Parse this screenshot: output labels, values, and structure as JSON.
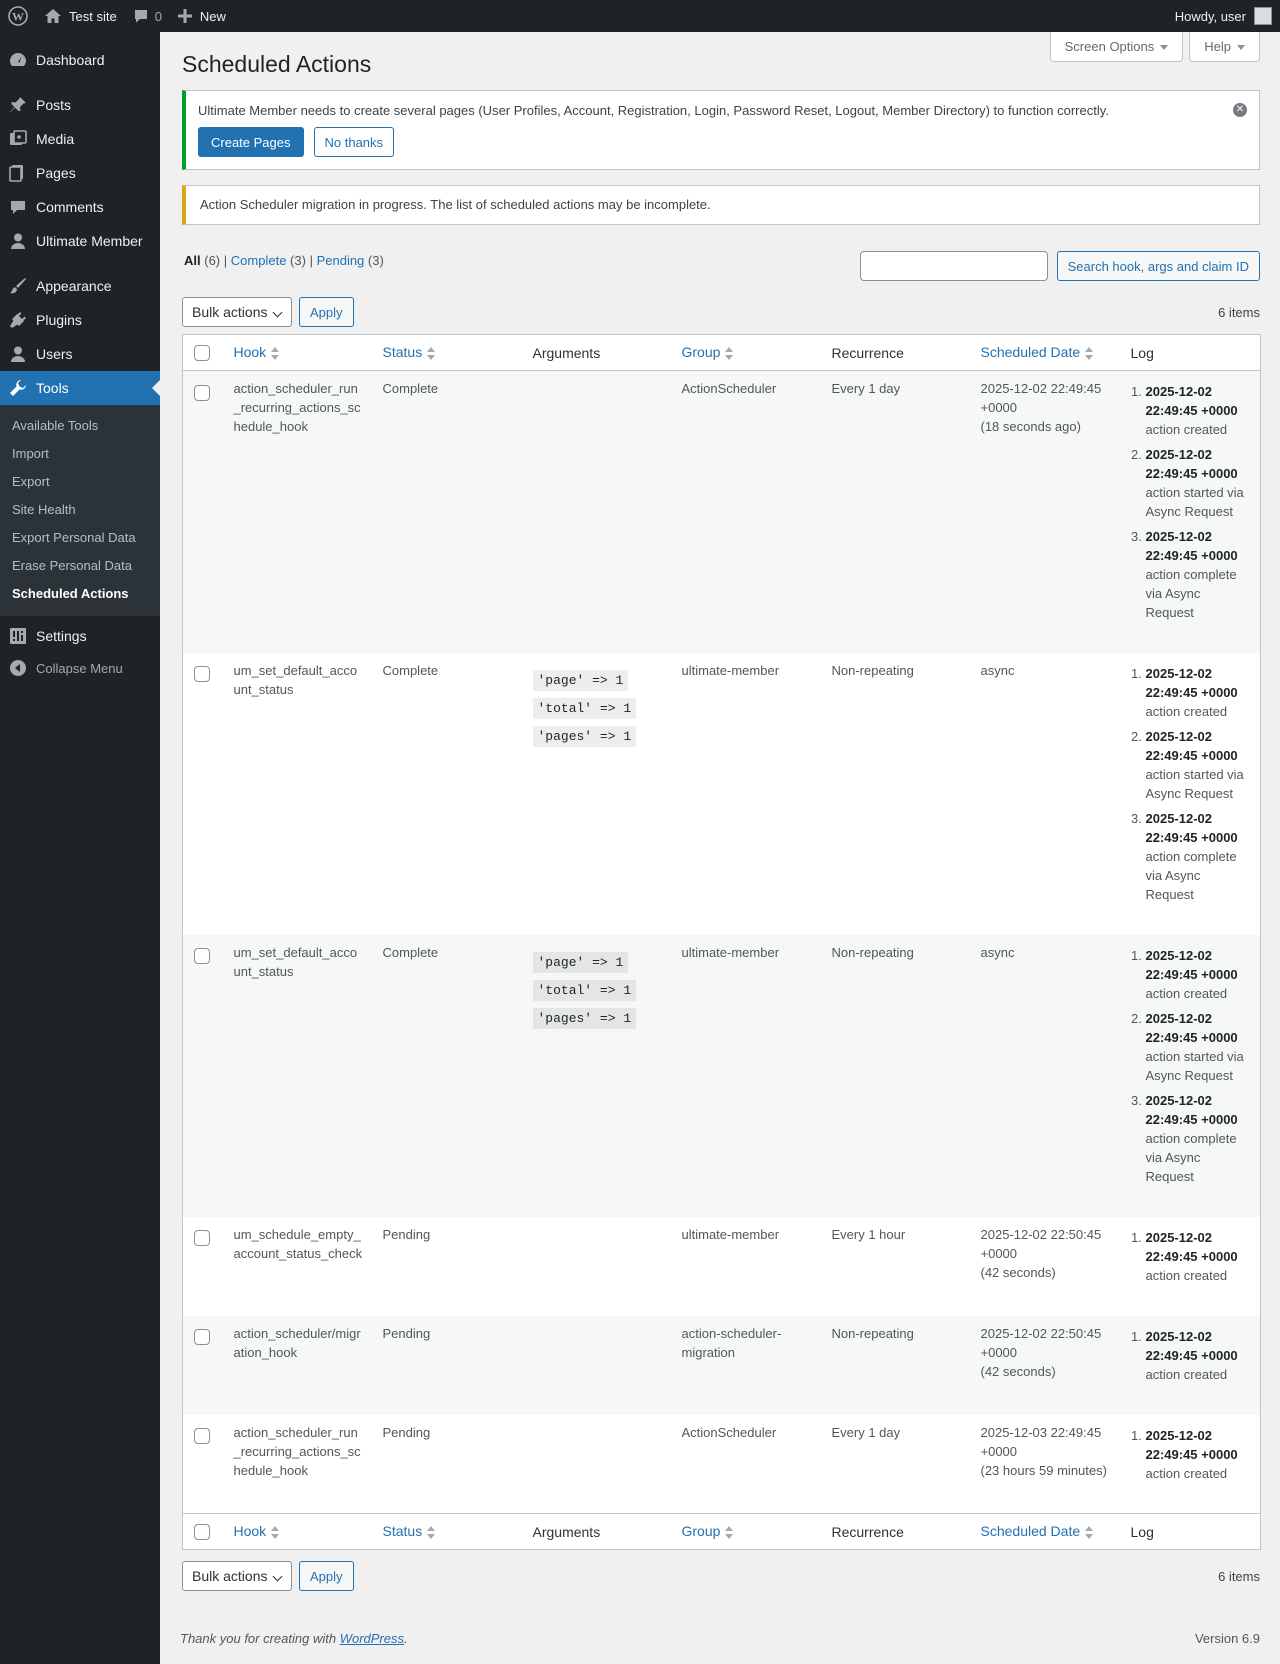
{
  "adminbar": {
    "site_name": "Test site",
    "comments_count": "0",
    "new_label": "New",
    "howdy": "Howdy, user"
  },
  "sidebar": {
    "items": [
      {
        "label": "Dashboard",
        "icon": "dashboard-icon"
      },
      {
        "label": "Posts",
        "icon": "pin-icon"
      },
      {
        "label": "Media",
        "icon": "media-icon"
      },
      {
        "label": "Pages",
        "icon": "pages-icon"
      },
      {
        "label": "Comments",
        "icon": "comment-icon"
      },
      {
        "label": "Ultimate Member",
        "icon": "user-icon"
      },
      {
        "label": "Appearance",
        "icon": "brush-icon"
      },
      {
        "label": "Plugins",
        "icon": "plug-icon"
      },
      {
        "label": "Users",
        "icon": "users-icon"
      },
      {
        "label": "Tools",
        "icon": "wrench-icon"
      },
      {
        "label": "Settings",
        "icon": "settings-icon"
      },
      {
        "label": "Collapse Menu",
        "icon": "collapse-icon"
      }
    ],
    "tools_submenu": [
      "Available Tools",
      "Import",
      "Export",
      "Site Health",
      "Export Personal Data",
      "Erase Personal Data",
      "Scheduled Actions"
    ]
  },
  "screen_meta": {
    "screen_options": "Screen Options",
    "help": "Help"
  },
  "page_title": "Scheduled Actions",
  "notice_um": {
    "text": "Ultimate Member needs to create several pages (User Profiles, Account, Registration, Login, Password Reset, Logout, Member Directory) to function correctly.",
    "create_pages": "Create Pages",
    "no_thanks": "No thanks"
  },
  "notice_migration": "Action Scheduler migration in progress. The list of scheduled actions may be incomplete.",
  "filters": {
    "all": "All",
    "all_count": "(6)",
    "complete": "Complete",
    "complete_count": "(3)",
    "pending": "Pending",
    "pending_count": "(3)",
    "sep": "|"
  },
  "search": {
    "button": "Search hook, args and claim ID",
    "value": ""
  },
  "bulk": {
    "select": "Bulk actions",
    "apply": "Apply",
    "items": "6 items"
  },
  "columns": {
    "hook": "Hook",
    "status": "Status",
    "arguments": "Arguments",
    "group": "Group",
    "recurrence": "Recurrence",
    "scheduled": "Scheduled Date",
    "log": "Log"
  },
  "rows": [
    {
      "hook": "action_scheduler_run_recurring_actions_schedule_hook",
      "status": "Complete",
      "args": [],
      "group": "ActionScheduler",
      "recurrence": "Every 1 day",
      "sched_date": "2025-12-02 22:49:45",
      "sched_tz": "+0000",
      "sched_rel": "(18 seconds ago)",
      "log": [
        {
          "date": "2025-12-02 22:49:45 +0000",
          "msg": "action created"
        },
        {
          "date": "2025-12-02 22:49:45 +0000",
          "msg": "action started via Async Request"
        },
        {
          "date": "2025-12-02 22:49:45 +0000",
          "msg": "action complete via Async Request"
        }
      ]
    },
    {
      "hook": "um_set_default_account_status",
      "status": "Complete",
      "args": [
        "'page' => 1",
        "'total' => 1",
        "'pages' => 1"
      ],
      "group": "ultimate-member",
      "recurrence": "Non-repeating",
      "sched_date": "async",
      "sched_tz": "",
      "sched_rel": "",
      "log": [
        {
          "date": "2025-12-02 22:49:45 +0000",
          "msg": "action created"
        },
        {
          "date": "2025-12-02 22:49:45 +0000",
          "msg": "action started via Async Request"
        },
        {
          "date": "2025-12-02 22:49:45 +0000",
          "msg": "action complete via Async Request"
        }
      ]
    },
    {
      "hook": "um_set_default_account_status",
      "status": "Complete",
      "args": [
        "'page' => 1",
        "'total' => 1",
        "'pages' => 1"
      ],
      "group": "ultimate-member",
      "recurrence": "Non-repeating",
      "sched_date": "async",
      "sched_tz": "",
      "sched_rel": "",
      "log": [
        {
          "date": "2025-12-02 22:49:45 +0000",
          "msg": "action created"
        },
        {
          "date": "2025-12-02 22:49:45 +0000",
          "msg": "action started via Async Request"
        },
        {
          "date": "2025-12-02 22:49:45 +0000",
          "msg": "action complete via Async Request"
        }
      ]
    },
    {
      "hook": "um_schedule_empty_account_status_check",
      "status": "Pending",
      "args": [],
      "group": "ultimate-member",
      "recurrence": "Every 1 hour",
      "sched_date": "2025-12-02 22:50:45",
      "sched_tz": "+0000",
      "sched_rel": "(42 seconds)",
      "log": [
        {
          "date": "2025-12-02 22:49:45 +0000",
          "msg": "action created"
        }
      ]
    },
    {
      "hook": "action_scheduler/migration_hook",
      "status": "Pending",
      "args": [],
      "group": "action-scheduler-migration",
      "recurrence": "Non-repeating",
      "sched_date": "2025-12-02 22:50:45",
      "sched_tz": "+0000",
      "sched_rel": "(42 seconds)",
      "log": [
        {
          "date": "2025-12-02 22:49:45 +0000",
          "msg": "action created"
        }
      ]
    },
    {
      "hook": "action_scheduler_run_recurring_actions_schedule_hook",
      "status": "Pending",
      "args": [],
      "group": "ActionScheduler",
      "recurrence": "Every 1 day",
      "sched_date": "2025-12-03 22:49:45",
      "sched_tz": "+0000",
      "sched_rel": "(23 hours 59 minutes)",
      "log": [
        {
          "date": "2025-12-02 22:49:45 +0000",
          "msg": "action created"
        }
      ]
    }
  ],
  "footer": {
    "thanks_prefix": "Thank you for creating with ",
    "wordpress": "WordPress",
    "thanks_suffix": ".",
    "version": "Version 6.9"
  }
}
